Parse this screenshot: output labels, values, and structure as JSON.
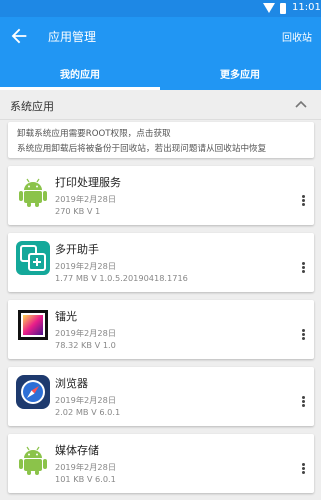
{
  "status_bar": {
    "time": "11:01"
  },
  "app_bar": {
    "title": "应用管理",
    "recycle_label": "回收站"
  },
  "tabs": [
    {
      "label": "我的应用",
      "selected": true
    },
    {
      "label": "更多应用",
      "selected": false
    }
  ],
  "section": {
    "title": "系统应用"
  },
  "notice": {
    "line1": "卸载系统应用需要ROOT权限，点击获取",
    "line2": "系统应用卸载后将被备份于回收站，若出现问题请从回收站中恢复"
  },
  "apps": [
    {
      "name": "打印处理服务",
      "date": "2019年2月28日",
      "size": "270 KB   V 1",
      "icon": "android-icon"
    },
    {
      "name": "多开助手",
      "date": "2019年2月28日",
      "size": "1.77 MB   V 1.0.5.20190418.1716",
      "icon": "multi-open-icon"
    },
    {
      "name": "镭光",
      "date": "2019年2月28日",
      "size": "78.32 KB   V 1.0",
      "icon": "gallery-icon"
    },
    {
      "name": "浏览器",
      "date": "2019年2月28日",
      "size": "2.02 MB   V 6.0.1",
      "icon": "browser-compass-icon"
    },
    {
      "name": "媒体存储",
      "date": "2019年2月28日",
      "size": "101 KB   V 6.0.1",
      "icon": "android-icon"
    }
  ],
  "colors": {
    "primary": "#2196f3",
    "status_bar": "#1e88e5",
    "android_green": "#8bc34a"
  }
}
